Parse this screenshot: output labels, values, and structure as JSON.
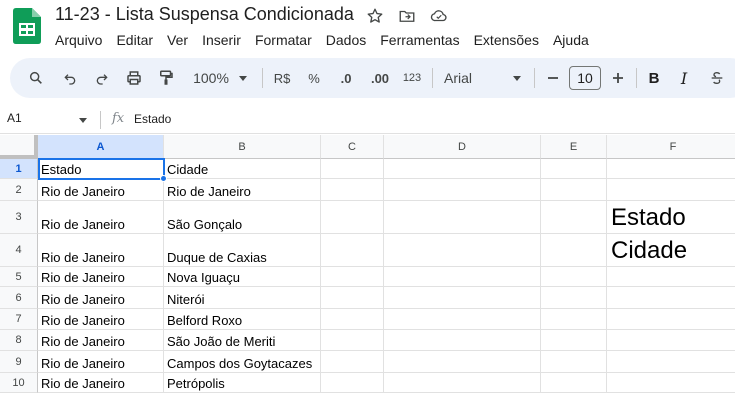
{
  "document": {
    "title": "11-23 - Lista Suspensa Condicionada"
  },
  "menu": [
    "Arquivo",
    "Editar",
    "Ver",
    "Inserir",
    "Formatar",
    "Dados",
    "Ferramentas",
    "Extensões",
    "Ajuda"
  ],
  "toolbar": {
    "zoom": "100%",
    "currency": "R$",
    "percent": "%",
    "decrease_decimals": ".0",
    "increase_decimals": ".00",
    "more_formats": "123",
    "font": "Arial",
    "font_size": "10",
    "bold": "B",
    "italic": "I"
  },
  "formula_bar": {
    "cell_ref": "A1",
    "fx": "fx",
    "content": "Estado"
  },
  "columns": [
    "A",
    "B",
    "C",
    "D",
    "E",
    "F"
  ],
  "rows": [
    "1",
    "2",
    "3",
    "4",
    "5",
    "6",
    "7",
    "8",
    "9",
    "10"
  ],
  "cells": {
    "A": [
      "Estado",
      "Rio de Janeiro",
      "Rio de Janeiro",
      "Rio de Janeiro",
      "Rio de Janeiro",
      "Rio de Janeiro",
      "Rio de Janeiro",
      "Rio de Janeiro",
      "Rio de Janeiro",
      "Rio de Janeiro"
    ],
    "B": [
      "Cidade",
      "Rio de Janeiro",
      "São Gonçalo",
      "Duque de Caxias",
      "Nova Iguaçu",
      "Niterói",
      "Belford Roxo",
      "São João de Meriti",
      "Campos dos Goytacazes",
      "Petrópolis"
    ],
    "F": [
      "Estado",
      "Cidade"
    ]
  },
  "selection": "A1",
  "colors": {
    "accent": "#1a73e8",
    "header_active": "#d3e3fd",
    "toolbar_bg": "#edf2fa",
    "sheets_green": "#0f9d58"
  },
  "icons": [
    "sheets-logo-icon",
    "star-icon",
    "move-folder-icon",
    "cloud-saved-icon",
    "search-icon",
    "undo-icon",
    "redo-icon",
    "print-icon",
    "paint-format-icon",
    "caret-down-icon",
    "minus-icon",
    "plus-icon",
    "strikethrough-icon"
  ]
}
